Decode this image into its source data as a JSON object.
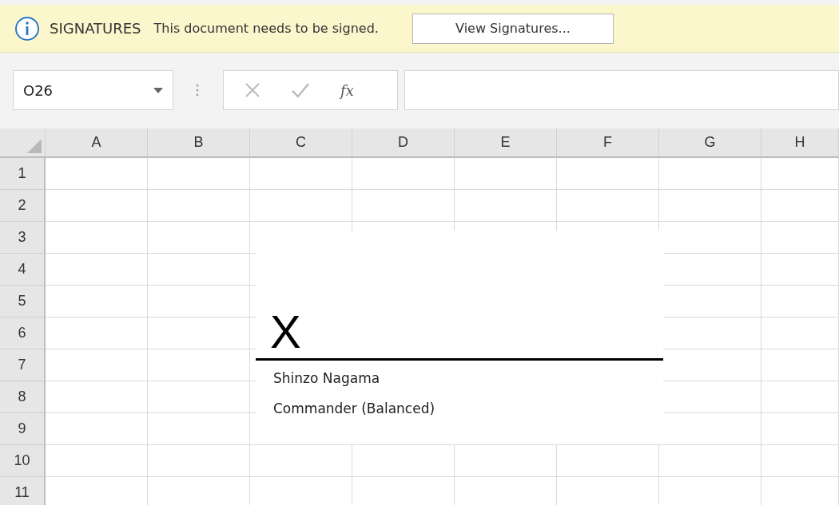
{
  "message_bar": {
    "title": "SIGNATURES",
    "message": "This document needs to be signed.",
    "button": "View Signatures..."
  },
  "name_box": {
    "value": "O26"
  },
  "formula_bar": {
    "function_label": "fx"
  },
  "sheet": {
    "columns": [
      "A",
      "B",
      "C",
      "D",
      "E",
      "F",
      "G",
      "H"
    ],
    "rows": [
      "1",
      "2",
      "3",
      "4",
      "5",
      "6",
      "7",
      "8",
      "9",
      "10",
      "11"
    ]
  },
  "signature_line": {
    "mark": "X",
    "signer_name": "Shinzo Nagama",
    "signer_title": "Commander (Balanced)"
  }
}
